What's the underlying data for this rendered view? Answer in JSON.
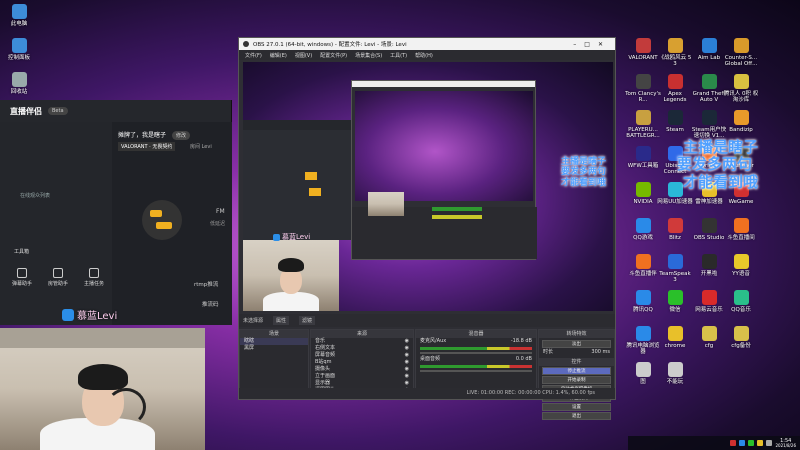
{
  "desktop_left": [
    {
      "label": "此电脑",
      "color": "#3d8cd8"
    },
    {
      "label": "控制面板",
      "color": "#3d8cd8"
    },
    {
      "label": "回收站",
      "color": "#9aa"
    }
  ],
  "desktop_right": [
    {
      "label": "VALORANT",
      "color": "#c23b3b"
    },
    {
      "label": "《战鸥风云 5 3",
      "color": "#d8a030"
    },
    {
      "label": "Aim Lab",
      "color": "#2b7fd6"
    },
    {
      "label": "Counter-S... Global Off...",
      "color": "#d89a2a"
    },
    {
      "label": "Tom Clancy's R...",
      "color": "#444"
    },
    {
      "label": "Apex Legends",
      "color": "#c83030"
    },
    {
      "label": "Grand Theft Auto V",
      "color": "#2a8a4a"
    },
    {
      "label": "腾讯人  0积 权 淘沙库",
      "color": "#d8c040"
    },
    {
      "label": "PLAYERU... BATTLEGR...",
      "color": "#c8a040"
    },
    {
      "label": "Steam",
      "color": "#1b2838"
    },
    {
      "label": "Steam用户快速切换 V1...",
      "color": "#1b2838"
    },
    {
      "label": "Bandizip",
      "color": "#e89a2a"
    },
    {
      "label": "WFW工具箱",
      "color": "#2a2a8a"
    },
    {
      "label": "Ubisoft Connect",
      "color": "#2f6ae8"
    },
    {
      "label": "Origin",
      "color": "#f06a2a"
    },
    {
      "label": "Launcher",
      "color": "#333"
    },
    {
      "label": "NVIDIA",
      "color": "#76b900"
    },
    {
      "label": "网易UU加速器",
      "color": "#2ab8d8"
    },
    {
      "label": "雷神加速器",
      "color": "#e8c02a"
    },
    {
      "label": "WeGame",
      "color": "#d03030"
    },
    {
      "label": "QQ游戏",
      "color": "#2a8ae8"
    },
    {
      "label": "Blitz",
      "color": "#d03a3a"
    },
    {
      "label": "OBS Studio",
      "color": "#333"
    },
    {
      "label": "斗鱼直播间",
      "color": "#f07020"
    },
    {
      "label": "斗鱼直播伴",
      "color": "#f07020"
    },
    {
      "label": "TeamSpeak 3",
      "color": "#2a6ad8"
    },
    {
      "label": "开黑啦",
      "color": "#2a2a2a"
    },
    {
      "label": "YY语音",
      "color": "#e8c82a"
    },
    {
      "label": "腾讯QQ",
      "color": "#2a8ae8"
    },
    {
      "label": "微信",
      "color": "#2ac02a"
    },
    {
      "label": "网易云音乐",
      "color": "#d82a2a"
    },
    {
      "label": "QQ音乐",
      "color": "#2ac08a"
    },
    {
      "label": "腾讯电脑浏览器",
      "color": "#2a8ae8"
    },
    {
      "label": "chrome",
      "color": "#e8c02a"
    },
    {
      "label": "cfg",
      "color": "#d8c04a"
    },
    {
      "label": "cfg备份",
      "color": "#d8c04a"
    },
    {
      "label": "图",
      "color": "#ccc"
    },
    {
      "label": "不能玩",
      "color": "#ccc"
    }
  ],
  "tool": {
    "logo": "直播伴侣",
    "badge": "Beta",
    "heading": "摊牌了，我是瞎子",
    "badge2": "修改",
    "game": "VALORANT · 无畏契约",
    "room": "房间 Levi",
    "empty_hint": "在线观众列表",
    "section_label": "工具箱",
    "items": [
      "弹幕助手",
      "房管助手",
      "主播任务"
    ],
    "rtmp_label": "rtmp推流",
    "key_label": "推流码",
    "mid_label": "FM",
    "mid_sub": "低延迟"
  },
  "obs": {
    "title": "OBS 27.0.1 (64-bit, windows) - 配置文件: Levi - 场景: Levi",
    "menu": [
      "文件(F)",
      "编辑(E)",
      "视图(V)",
      "配置文件(P)",
      "场景集合(S)",
      "工具(T)",
      "帮助(H)"
    ],
    "panels": {
      "scenes": "场景",
      "sources": "来源",
      "mixer": "混音器",
      "transitions": "转场特效",
      "controls": "控件"
    },
    "scenes": [
      "瞎瞎",
      "黑屏"
    ],
    "sources": [
      "音乐",
      "右侧文本",
      "屏幕音频",
      "B站qm",
      "摄像头",
      "立于画面",
      "显示器",
      "逗图图片"
    ],
    "mixer": [
      {
        "name": "麦克风/Aux",
        "db": "-18.8 dB"
      },
      {
        "name": "桌面音频",
        "db": "0.0 dB"
      }
    ],
    "transition": "淡出",
    "duration_label": "时长",
    "duration": "300 ms",
    "controls": [
      "停止推流",
      "开始录制",
      "启动虚拟摄像机",
      "工作室模式",
      "设置",
      "退出"
    ],
    "status": "LIVE: 01:00:00   REC: 00:00:00   CPU: 1.4%, 60.00 fps",
    "no_source": "未选择源",
    "props": "属性",
    "filters": "滤镜"
  },
  "overlay": {
    "lines": [
      "主播是瞎子",
      "要发多两句",
      "才能看到哦"
    ],
    "cam_label": "慕蓝Levi",
    "cam_label2": "慕蓝Levi"
  },
  "clock": {
    "time": "1:54",
    "date": "2021/8/26"
  }
}
